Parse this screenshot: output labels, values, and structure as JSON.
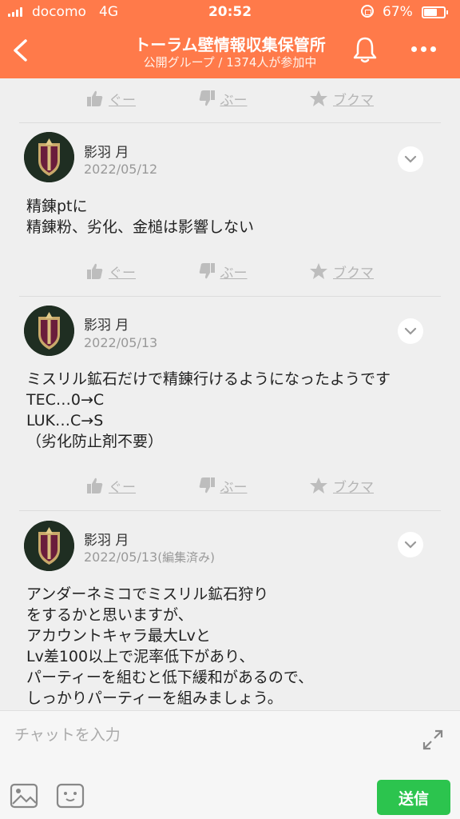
{
  "status_bar": {
    "carrier": "docomo",
    "network": "4G",
    "time": "20:52",
    "battery_percent": "67%",
    "battery_level": 0.67
  },
  "header": {
    "title": "トーラム壁情報収集保管所",
    "subtitle": "公開グループ / 1374人が参加中",
    "icons": [
      "back-icon",
      "bell-icon",
      "more-icon"
    ]
  },
  "reactions": {
    "good": "ぐー",
    "bad": "ぶー",
    "bookmark": "ブクマ"
  },
  "messages": [
    {
      "author": "影羽 月",
      "date": "2022/05/12",
      "edited": "",
      "lines": [
        "精錬ptに",
        "精錬粉、劣化、金槌は影響しない"
      ]
    },
    {
      "author": "影羽 月",
      "date": "2022/05/13",
      "edited": "",
      "lines": [
        "ミスリル鉱石だけで精錬行けるようになったようです",
        "TEC…0→C",
        "LUK…C→S",
        "（劣化防止剤不要）"
      ]
    },
    {
      "author": "影羽 月",
      "date": "2022/05/13",
      "edited": "(編集済み)",
      "lines": [
        "アンダーネミコでミスリル鉱石狩り",
        "をするかと思いますが、",
        "アカウントキャラ最大Lvと",
        "Lv差100以上で泥率低下があり、",
        "パーティーを組むと低下緩和があるので、",
        "しっかりパーティーを組みましょう。"
      ]
    }
  ],
  "composer": {
    "placeholder": "チャットを入力",
    "send_label": "送信"
  },
  "colors": {
    "header_bg": "#ff7a4a",
    "send_button": "#2cc44e",
    "background": "#efefef"
  }
}
